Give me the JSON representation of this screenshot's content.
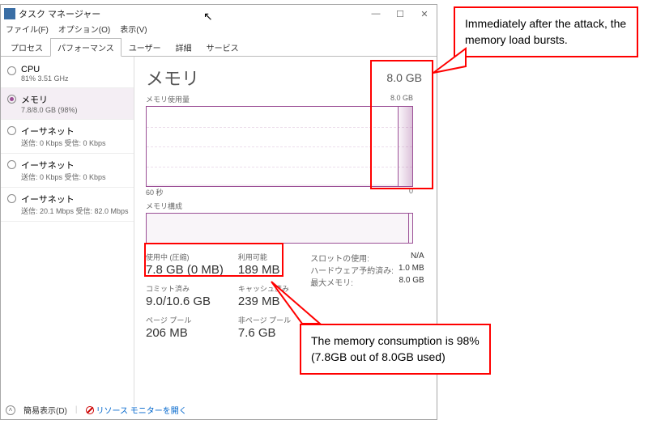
{
  "window": {
    "title": "タスク マネージャー",
    "menu": {
      "file": "ファイル(F)",
      "options": "オプション(O)",
      "view": "表示(V)"
    },
    "controls": {
      "min": "—",
      "max": "☐",
      "close": "✕"
    }
  },
  "tabs": {
    "processes": "プロセス",
    "performance": "パフォーマンス",
    "users": "ユーザー",
    "details": "詳細",
    "services": "サービス"
  },
  "sidebar": [
    {
      "name": "CPU",
      "detail": "81%  3.51 GHz",
      "selected": false
    },
    {
      "name": "メモリ",
      "detail": "7.8/8.0 GB (98%)",
      "selected": true
    },
    {
      "name": "イーサネット",
      "detail": "送信: 0 Kbps 受信: 0 Kbps",
      "selected": false
    },
    {
      "name": "イーサネット",
      "detail": "送信: 0 Kbps 受信: 0 Kbps",
      "selected": false
    },
    {
      "name": "イーサネット",
      "detail": "送信: 20.1 Mbps 受信: 82.0 Mbps",
      "selected": false
    }
  ],
  "main": {
    "title": "メモリ",
    "top_value": "8.0 GB",
    "usage_label": "メモリ使用量",
    "usage_max": "8.0 GB",
    "axis_left": "60 秒",
    "axis_right": "0",
    "composition_label": "メモリ構成",
    "stats": {
      "in_use_label": "使用中 (圧縮)",
      "in_use_value": "7.8 GB (0 MB)",
      "available_label": "利用可能",
      "available_value": "189 MB",
      "committed_label": "コミット済み",
      "committed_value": "9.0/10.6 GB",
      "cached_label": "キャッシュ済み",
      "cached_value": "239 MB",
      "paged_label": "ページ プール",
      "paged_value": "206 MB",
      "nonpaged_label": "非ページ プール",
      "nonpaged_value": "7.6 GB"
    },
    "kv": {
      "slot_label": "スロットの使用:",
      "slot_value": "N/A",
      "hw_label": "ハードウェア予約済み:",
      "hw_value": "1.0 MB",
      "max_label": "最大メモリ:",
      "max_value": "8.0 GB"
    }
  },
  "chart_data": {
    "type": "area",
    "title": "メモリ使用量",
    "xlabel": "60 秒",
    "ylabel": "GB",
    "ylim": [
      0,
      8.0
    ],
    "x": [
      0,
      58,
      59,
      60
    ],
    "values": [
      0.2,
      0.2,
      7.8,
      7.8
    ],
    "note": "Flat near-zero usage spikes to ~7.8GB at right edge (attack onset)"
  },
  "footer": {
    "simple_view": "簡易表示(D)",
    "resource_link": "リソース モニターを開く"
  },
  "annotations": {
    "callout1": "Immediately after the attack, the memory load bursts.",
    "callout2": "The memory consumption is 98% (7.8GB out of 8.0GB used)"
  }
}
